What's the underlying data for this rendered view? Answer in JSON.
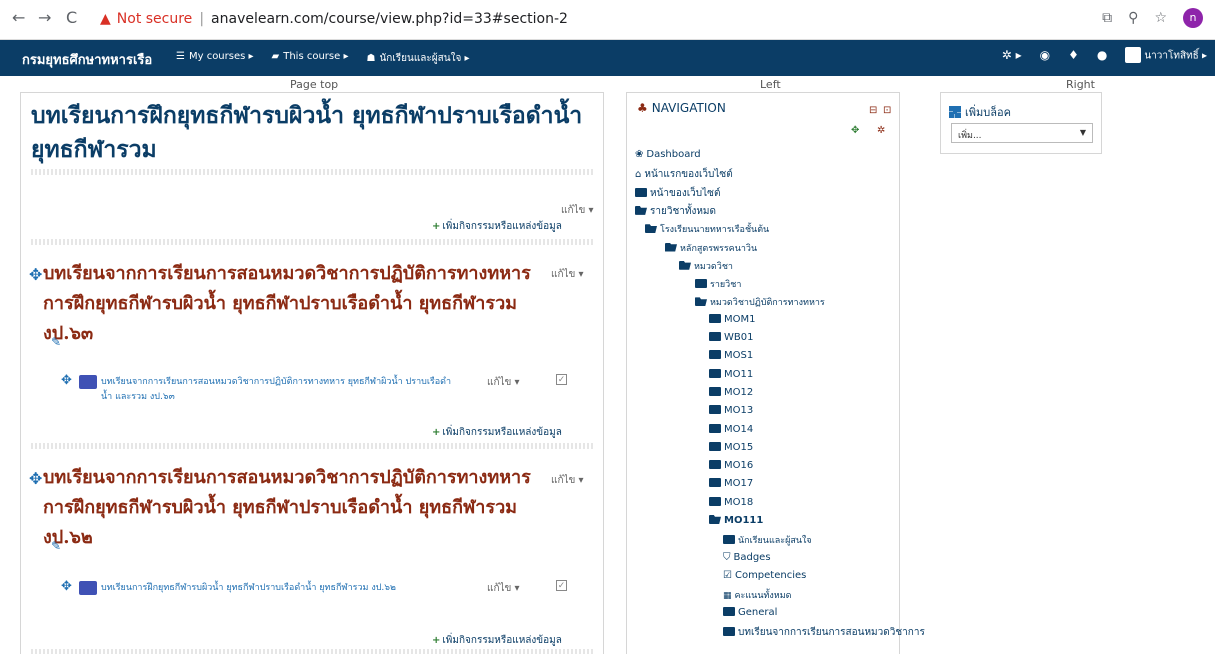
{
  "browser": {
    "security": "Not secure",
    "url": "anavelearn.com/course/view.php?id=33#section-2",
    "profile_letter": "n"
  },
  "navbar": {
    "brand": "กรมยุทธศึกษาทหารเรือ",
    "menu": [
      "My courses ▸",
      "This course ▸",
      "นักเรียนและผู้สนใจ ▸"
    ],
    "user": "นาวาโทสิทธิ์ ▸"
  },
  "regions": {
    "top": "Page top",
    "left": "Left",
    "right": "Right"
  },
  "course": {
    "title": "บทเรียนการฝึกยุทธกีฬารบผิวน้ำ ยุทธกีฬาปราบเรือดำน้ำ ยุทธกีฬารวม",
    "edit": "แก้ไข ▾",
    "add_activity": "เพิ่มกิจกรรมหรือแหล่งข้อมูล",
    "sections": [
      {
        "title": "บทเรียนจากการเรียนการสอนหมวดวิชาการปฏิบัติการทางทหาร การฝึกยุทธกีฬารบผิวน้ำ ยุทธกีฬาปราบเรือดำน้ำ ยุทธกีฬารวม งป.๖๓",
        "edit": "แก้ไข ▾",
        "activity": "บทเรียนจากการเรียนการสอนหมวดวิชาการปฏิบัติการทางทหาร ยุทธกีฬาผิวน้ำ ปราบเรือดำน้ำ และรวม งป.๖๓",
        "activity_edit": "แก้ไข ▾",
        "add_activity": "เพิ่มกิจกรรมหรือแหล่งข้อมูล"
      },
      {
        "title": "บทเรียนจากการเรียนการสอนหมวดวิชาการปฏิบัติการทางทหาร การฝึกยุทธกีฬารบผิวน้ำ ยุทธกีฬาปราบเรือดำน้ำ ยุทธกีฬารวม งป.๖๒",
        "edit": "แก้ไข ▾",
        "activity": "บทเรียนการฝึกยุทธกีฬารบผิวน้ำ ยุทธกีฬาปราบเรือดำน้ำ ยุทธกีฬารวม งป.๖๒",
        "activity_edit": "แก้ไข ▾",
        "add_activity": "เพิ่มกิจกรรมหรือแหล่งข้อมูล"
      }
    ]
  },
  "navigation": {
    "title": "NAVIGATION",
    "items": [
      {
        "label": "Dashboard",
        "icon": "dashboard-icon"
      },
      {
        "label": "หน้าแรกของเว็บไซต์",
        "icon": "home-icon"
      },
      {
        "label": "หน้าของเว็บไซต์",
        "icon": "folder-icon"
      },
      {
        "label": "รายวิชาทั้งหมด",
        "icon": "folder-open-icon"
      },
      {
        "label": "โรงเรียนนายทหารเรือชั้นต้น",
        "icon": "folder-open-icon"
      },
      {
        "label": "หลักสูตรพรรคนาวิน",
        "icon": "folder-open-icon"
      },
      {
        "label": "หมวดวิชา",
        "icon": "folder-open-icon"
      },
      {
        "label": "รายวิชา",
        "icon": "folder-icon"
      },
      {
        "label": "หมวดวิชาปฏิบัติการทางทหาร",
        "icon": "folder-open-icon"
      },
      {
        "label": "MOM1",
        "icon": "folder-icon"
      },
      {
        "label": "WB01",
        "icon": "folder-icon"
      },
      {
        "label": "MOS1",
        "icon": "folder-icon"
      },
      {
        "label": "MO11",
        "icon": "folder-icon"
      },
      {
        "label": "MO12",
        "icon": "folder-icon"
      },
      {
        "label": "MO13",
        "icon": "folder-icon"
      },
      {
        "label": "MO14",
        "icon": "folder-icon"
      },
      {
        "label": "MO15",
        "icon": "folder-icon"
      },
      {
        "label": "MO16",
        "icon": "folder-icon"
      },
      {
        "label": "MO17",
        "icon": "folder-icon"
      },
      {
        "label": "MO18",
        "icon": "folder-icon"
      },
      {
        "label": "MO111",
        "icon": "folder-open-icon"
      },
      {
        "label": "นักเรียนและผู้สนใจ",
        "icon": "folder-icon"
      },
      {
        "label": "Badges",
        "icon": "shield-icon"
      },
      {
        "label": "Competencies",
        "icon": "checkbox-icon"
      },
      {
        "label": "คะแนนทั้งหมด",
        "icon": "table-icon"
      },
      {
        "label": "General",
        "icon": "folder-icon"
      },
      {
        "label": "บทเรียนจากการเรียนการสอนหมวดวิชาการ",
        "icon": "folder-icon"
      }
    ]
  },
  "add_block": {
    "title": "เพิ่มบล็อค",
    "select_value": "เพิ่ม..."
  }
}
